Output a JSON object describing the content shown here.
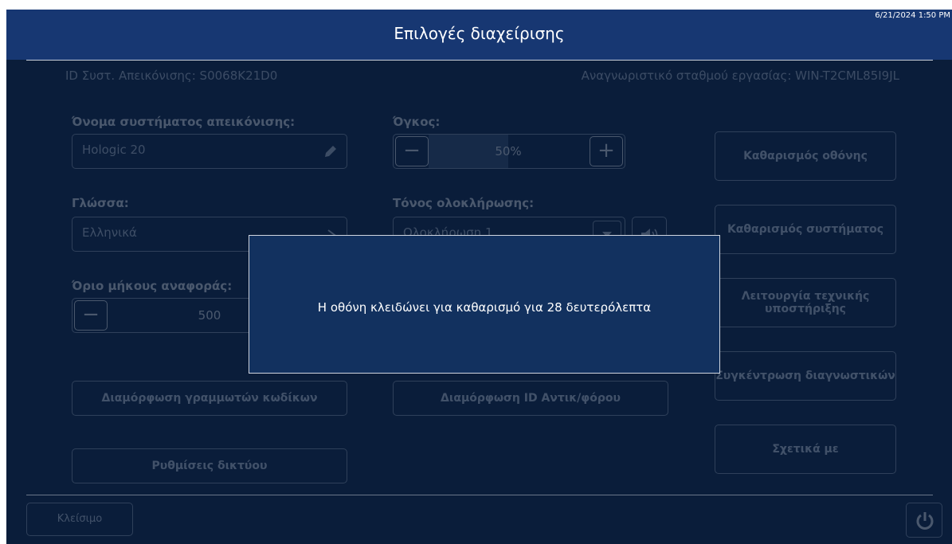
{
  "header": {
    "title": "Επιλογές διαχείρισης",
    "datetime": "6/21/2024 1:50 PM"
  },
  "info": {
    "system_id": "ID Συστ. Απεικόνισης: S0068K21D0",
    "workstation_id": "Αναγνωριστικό σταθμού εργασίας: WIN-T2CML85I9JL"
  },
  "system_name": {
    "label": "Όνομα συστήματος απεικόνισης:",
    "value": "Hologic 20"
  },
  "volume": {
    "label": "Όγκος:",
    "value": "50%",
    "level": 0.5
  },
  "language": {
    "label": "Γλώσσα:",
    "value": "Ελληνικά"
  },
  "completion_tone": {
    "label": "Τόνος ολοκλήρωσης:",
    "value": "Ολοκλήρωση 1"
  },
  "report_length": {
    "label": "Όριο μήκους αναφοράς:",
    "value": "500"
  },
  "buttons": {
    "barcode_config": "Διαμόρφωση γραμμωτών κωδίκων",
    "reagent_id_config": "Διαμόρφωση ID Αντικ/φόρου",
    "network_settings": "Ρυθμίσεις δικτύου",
    "clean_screen": "Καθαρισμός οθόνης",
    "clean_system": "Καθαρισμός συστήματος",
    "support_mode": "Λειτουργία τεχνικής υποστήριξης",
    "collect_diagnostics": "Συγκέντρωση διαγνωστικών",
    "about": "Σχετικά με",
    "close": "Κλείσιμο"
  },
  "dialog": {
    "message": "Η οθόνη κλειδώνει για καθαρισμό για 28 δευτερόλεπτα"
  },
  "colors": {
    "background": "#0a1d3a",
    "titlebar": "#173772",
    "dialog": "#12315f"
  }
}
